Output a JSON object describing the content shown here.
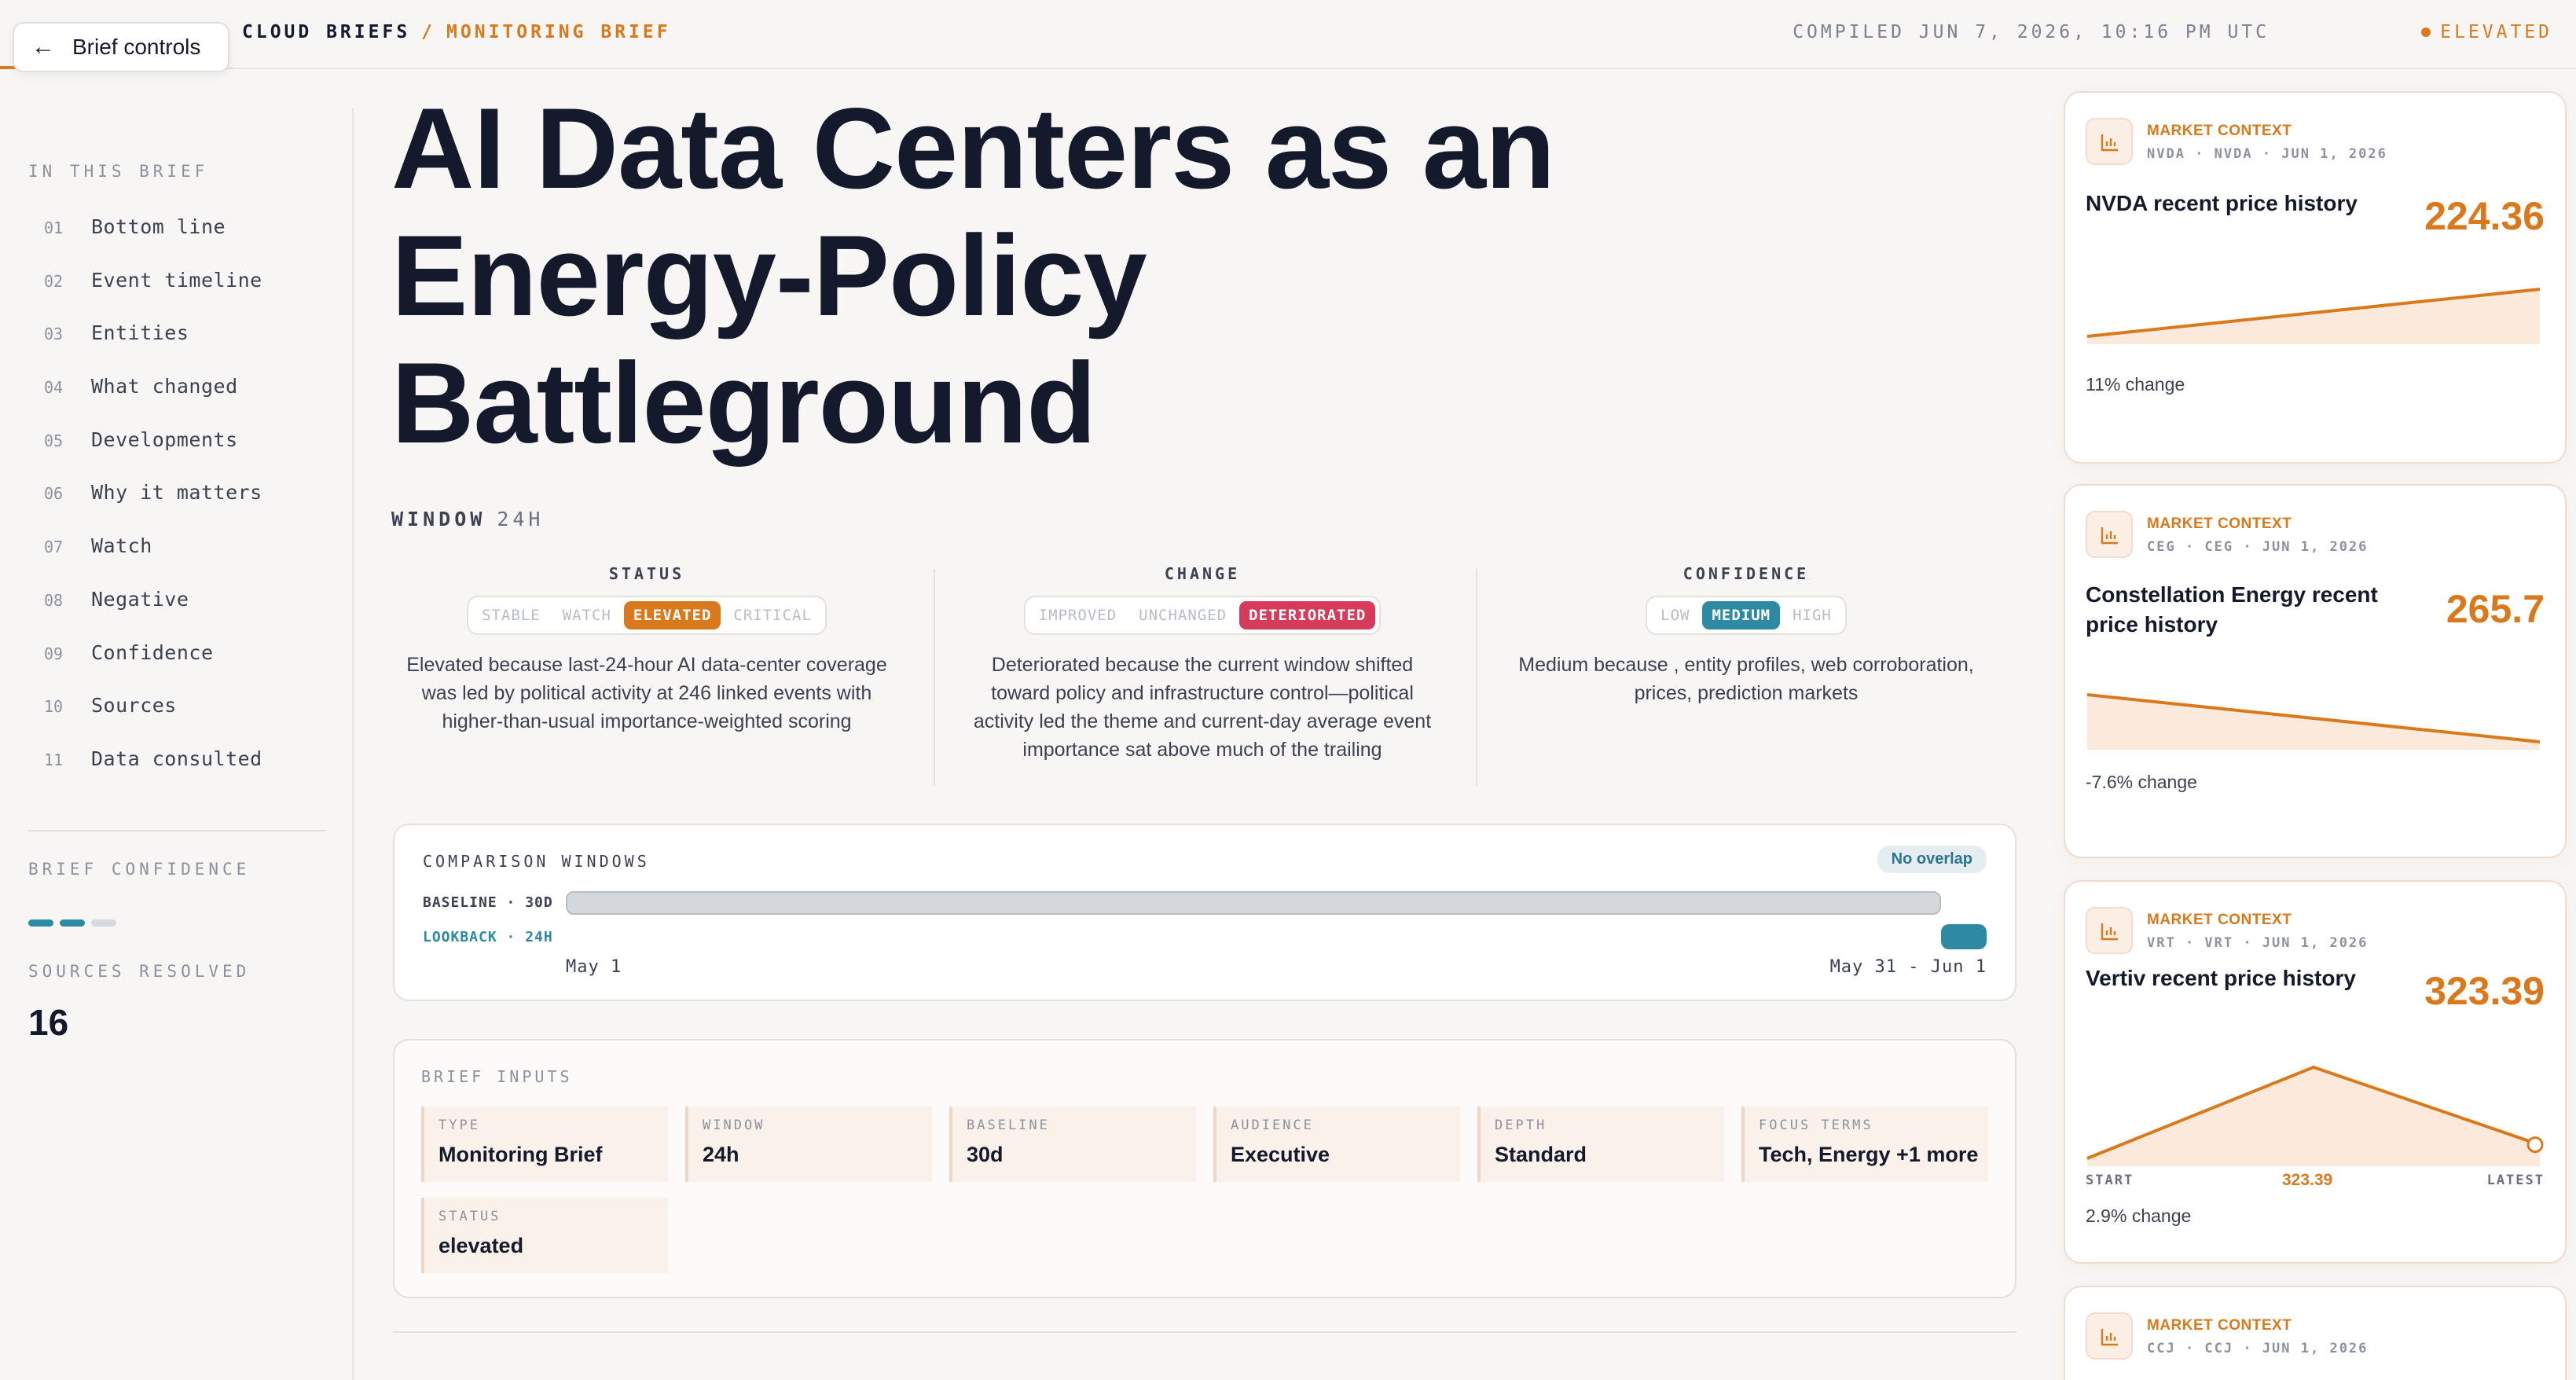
{
  "header": {
    "back_label": "Brief controls",
    "crumb_root": "CLOUD BRIEFS",
    "crumb_sep": "/",
    "crumb_current": "MONITORING BRIEF",
    "compiled": "COMPILED JUN 7, 2026, 10:16 PM UTC",
    "status": "ELEVATED"
  },
  "sidebar": {
    "heading": "IN THIS BRIEF",
    "items": [
      {
        "num": "01",
        "label": "Bottom line"
      },
      {
        "num": "02",
        "label": "Event timeline"
      },
      {
        "num": "03",
        "label": "Entities"
      },
      {
        "num": "04",
        "label": "What changed"
      },
      {
        "num": "05",
        "label": "Developments"
      },
      {
        "num": "06",
        "label": "Why it matters"
      },
      {
        "num": "07",
        "label": "Watch"
      },
      {
        "num": "08",
        "label": "Negative"
      },
      {
        "num": "09",
        "label": "Confidence"
      },
      {
        "num": "10",
        "label": "Sources"
      },
      {
        "num": "11",
        "label": "Data consulted"
      }
    ],
    "confidence_heading": "BRIEF CONFIDENCE",
    "confidence_level": 2,
    "confidence_max": 3,
    "sources_heading": "SOURCES RESOLVED",
    "sources_value": "16"
  },
  "main": {
    "title": "AI Data Centers as an Energy-Policy Battleground",
    "window_key": "WINDOW",
    "window_value": "24H",
    "status": {
      "heading": "STATUS",
      "options": [
        "STABLE",
        "WATCH",
        "ELEVATED",
        "CRITICAL"
      ],
      "selected": "ELEVATED",
      "description": "Elevated because last-24-hour AI data-center coverage was led by political activity at 246 linked events with higher-than-usual importance-weighted scoring"
    },
    "change": {
      "heading": "CHANGE",
      "options": [
        "IMPROVED",
        "UNCHANGED",
        "DETERIORATED"
      ],
      "selected": "DETERIORATED",
      "description": "Deteriorated because the current window shifted toward policy and infrastructure control—political activity led the theme and current-day average event importance sat above much of the trailing"
    },
    "confidence": {
      "heading": "CONFIDENCE",
      "options": [
        "LOW",
        "MEDIUM",
        "HIGH"
      ],
      "selected": "MEDIUM",
      "description": "Medium because , entity profiles, web corroboration, prices, prediction markets"
    },
    "comparison": {
      "heading": "COMPARISON WINDOWS",
      "badge": "No overlap",
      "baseline_label": "BASELINE · 30D",
      "lookback_label": "LOOKBACK · 24H",
      "start_date": "May 1",
      "end_date": "May 31 - Jun 1"
    },
    "inputs": {
      "heading": "BRIEF INPUTS",
      "fields": [
        {
          "key": "TYPE",
          "value": "Monitoring Brief"
        },
        {
          "key": "WINDOW",
          "value": "24h"
        },
        {
          "key": "BASELINE",
          "value": "30d"
        },
        {
          "key": "AUDIENCE",
          "value": "Executive"
        },
        {
          "key": "DEPTH",
          "value": "Standard"
        },
        {
          "key": "FOCUS TERMS",
          "value": "Tech, Energy +1 more"
        },
        {
          "key": "STATUS",
          "value": "elevated"
        }
      ]
    }
  },
  "market_cards": [
    {
      "label": "MARKET CONTEXT",
      "meta": "NVDA · NVDA · JUN 1, 2026",
      "title": "NVDA recent price history",
      "price": "224.36",
      "change": "11% change",
      "series": [
        0.0,
        1.0
      ]
    },
    {
      "label": "MARKET CONTEXT",
      "meta": "CEG · CEG · JUN 1, 2026",
      "title": "Constellation Energy recent price history",
      "price": "265.7",
      "change": "-7.6% change",
      "series": [
        1.0,
        0.0
      ]
    },
    {
      "label": "MARKET CONTEXT",
      "meta": "VRT · VRT · JUN 1, 2026",
      "title": "Vertiv recent price history",
      "price": "323.39",
      "change": "2.9% change",
      "series": [
        0.0,
        1.0,
        0.15
      ],
      "axis_start": "START",
      "axis_mid": "323.39",
      "axis_end": "LATEST"
    },
    {
      "label": "MARKET CONTEXT",
      "meta": "CCJ · CCJ · JUN 1, 2026"
    }
  ],
  "colors": {
    "accent": "#d9791c",
    "teal": "#2e8aa3",
    "red": "#d63b5b",
    "ink": "#141a2b"
  }
}
